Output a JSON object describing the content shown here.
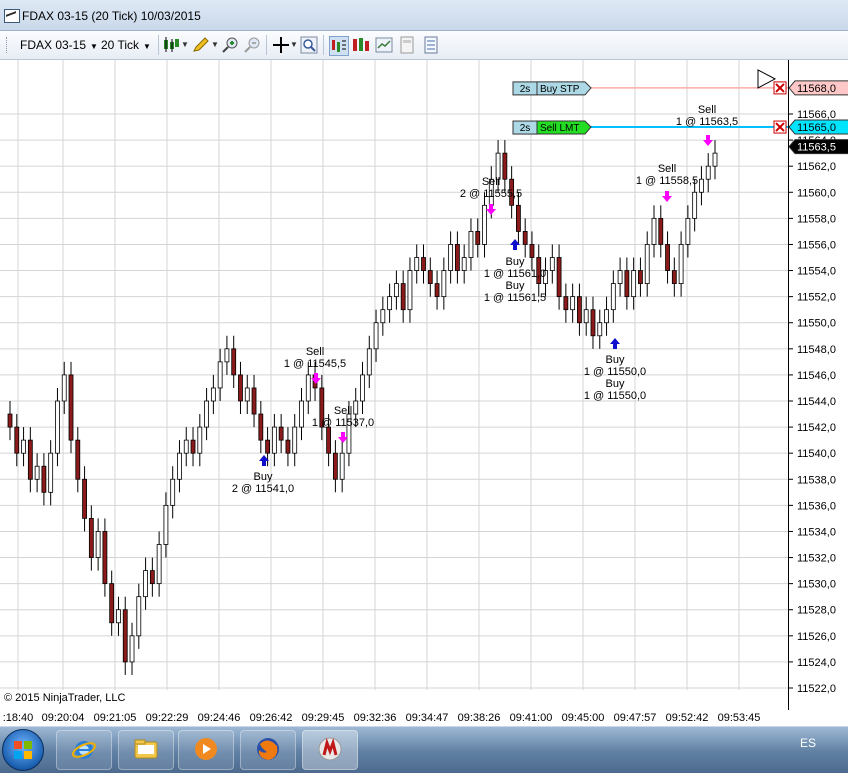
{
  "window": {
    "title": "FDAX 03-15 (20 Tick)  10/03/2015"
  },
  "toolbar": {
    "instrument": "FDAX 03-15",
    "interval": "20 Tick",
    "icons": [
      "candlestick-icon",
      "pencil-icon",
      "zoom-in-icon",
      "zoom-out-icon",
      "crosshair-icon",
      "magnifier-icon",
      "data-box-icon",
      "chart-trader-icon",
      "properties-icon",
      "layout-icon"
    ]
  },
  "chart": {
    "copyright": "© 2015 NinjaTrader, LLC",
    "colors": {
      "up": "#ffffff",
      "down": "#8b1a1a",
      "wick": "#000000",
      "grid": "#d4d4d4",
      "buy_marker": "#1010cc",
      "sell_marker": "#ff00ff",
      "buy_stop_line": "#ffaaaa",
      "sell_limit_line": "#00c0ff"
    },
    "price_ticks": [
      "11522,0",
      "11524,0",
      "11526,0",
      "11528,0",
      "11530,0",
      "11532,0",
      "11534,0",
      "11536,0",
      "11538,0",
      "11540,0",
      "11542,0",
      "11544,0",
      "11546,0",
      "11548,0",
      "11550,0",
      "11552,0",
      "11554,0",
      "11556,0",
      "11558,0",
      "11560,0",
      "11562,0",
      "11564,0",
      "11566,0"
    ],
    "time_ticks": [
      ":18:40",
      "09:20:04",
      "09:21:05",
      "09:22:29",
      "09:24:46",
      "09:26:42",
      "09:29:45",
      "09:32:36",
      "09:34:47",
      "09:38:26",
      "09:41:00",
      "09:45:00",
      "09:47:57",
      "09:52:42",
      "09:53:45"
    ],
    "last_price": "11563,5",
    "orders": [
      {
        "qty": "2s",
        "label": "Buy STP",
        "price": "11568,0",
        "type": "buy-stop"
      },
      {
        "qty": "2s",
        "label": "Sell LMT",
        "price": "11565,0",
        "type": "sell-limit"
      }
    ],
    "executions": [
      {
        "side": "Buy",
        "text": "2 @ 11541,0"
      },
      {
        "side": "Sell",
        "text": "1 @ 11545,5"
      },
      {
        "side": "Sell",
        "text": "1 @ 11537,0"
      },
      {
        "side": "Sell",
        "text": "2 @ 11555,5"
      },
      {
        "side": "Buy",
        "text": "1 @ 11561,0"
      },
      {
        "side": "Buy",
        "text": "1 @ 11561,5"
      },
      {
        "side": "Buy",
        "text": "1 @ 11550,0"
      },
      {
        "side": "Buy",
        "text": "1 @ 11550,0"
      },
      {
        "side": "Sell",
        "text": "1 @ 11558,5"
      },
      {
        "side": "Sell",
        "text": "1 @ 11563,5"
      }
    ]
  },
  "chart_data": {
    "type": "candlestick",
    "title": "FDAX 03-15 (20 Tick)",
    "ylim": [
      11521,
      11568
    ],
    "closes": [
      11542,
      11540,
      11541,
      11538,
      11539,
      11537,
      11540,
      11544,
      11546,
      11541,
      11538,
      11535,
      11532,
      11534,
      11530,
      11527,
      11528,
      11524,
      11526,
      11529,
      11531,
      11530,
      11533,
      11536,
      11538,
      11540,
      11541,
      11540,
      11542,
      11544,
      11545,
      11547,
      11548,
      11546,
      11544,
      11545,
      11543,
      11541,
      11540,
      11542,
      11541,
      11540,
      11542,
      11544,
      11546,
      11545,
      11542,
      11540,
      11538,
      11540,
      11543,
      11544,
      11546,
      11548,
      11550,
      11551,
      11552,
      11553,
      11551,
      11554,
      11555,
      11554,
      11553,
      11552,
      11554,
      11556,
      11554,
      11555,
      11557,
      11556,
      11559,
      11561,
      11563,
      11561,
      11559,
      11557,
      11556,
      11555,
      11553,
      11554,
      11555,
      11552,
      11551,
      11552,
      11550,
      11551,
      11549,
      11550,
      11551,
      11553,
      11554,
      11552,
      11554,
      11553,
      11556,
      11558,
      11556,
      11554,
      11553,
      11556,
      11558,
      11560,
      11561,
      11562,
      11563
    ]
  }
}
